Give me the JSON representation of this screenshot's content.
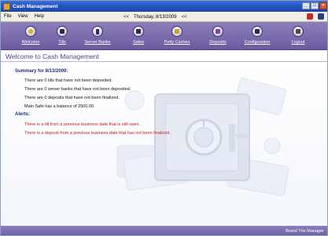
{
  "window": {
    "title": "Cash Management",
    "controls": [
      "_",
      "□",
      "×"
    ]
  },
  "menu": {
    "items": [
      "File",
      "View",
      "Help"
    ],
    "date_prev": "<<",
    "date": "Thursday, 8/13/2009",
    "date_next": "<<"
  },
  "toolbar": {
    "buttons": [
      {
        "label": "Welcome"
      },
      {
        "label": "Tills"
      },
      {
        "label": "Server Banks"
      },
      {
        "label": "Safes"
      },
      {
        "label": "Petty Cashes"
      },
      {
        "label": "Deposits"
      },
      {
        "label": "Configuration"
      },
      {
        "label": "Logout"
      }
    ]
  },
  "heading": "Welcome to Cash Management",
  "summary": {
    "title": "Summary for 8/13/2009:",
    "lines": [
      "There are 0 tills that have not been deposited.",
      "There are 0 server banks that have not been deposited.",
      "There are 0 deposits that have not been finalized.",
      "Main Safe has a balance of 2500.00."
    ]
  },
  "alerts": {
    "title": "Alerts:",
    "items": [
      "There is a till from a previous business date that is still open.",
      "There is a deposit from a previous business date that has not been finalized."
    ]
  },
  "footer": "Brand The Manager",
  "colors": {
    "titlebar": "#2356c4",
    "toolbar": "#7a6aab",
    "heading_text": "#5b3d8f",
    "summary_title": "#1f2e7a",
    "alert_text": "#d01818"
  }
}
